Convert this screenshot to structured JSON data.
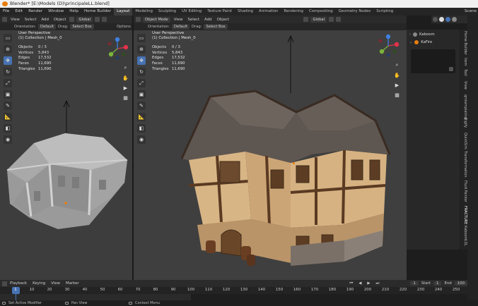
{
  "titlebar": {
    "title": "Blender* [E:\\Models (D)\\principaleLL.blend]"
  },
  "menu": {
    "items": [
      "File",
      "Edit",
      "Render",
      "Window",
      "Help",
      "Home Builder"
    ],
    "workspaces": [
      "Layout",
      "Modeling",
      "Sculpting",
      "UV Editing",
      "Texture Paint",
      "Shading",
      "Animation",
      "Rendering",
      "Compositing",
      "Geometry Nodes",
      "Scripting"
    ],
    "active_workspace": "Layout",
    "right": "Scene"
  },
  "vp_left": {
    "header": {
      "view": "View",
      "select": "Select",
      "add": "Add",
      "object": "Object",
      "transform": "Global",
      "mode": "Object Mode"
    },
    "sub": {
      "orientation_label": "Orientation:",
      "orientation": "Default",
      "drag_label": "Drag:",
      "drag": "Select Box",
      "options": "Options"
    },
    "overlay": {
      "line1": "User Perspective",
      "line2": "(1) Collection | Mesh_0"
    },
    "stats": [
      [
        "Objects",
        "0 / 3"
      ],
      [
        "Vertices",
        "5,843"
      ],
      [
        "Edges",
        "17,532"
      ],
      [
        "Faces",
        "11,690"
      ],
      [
        "Triangles",
        "11,690"
      ]
    ]
  },
  "vp_right": {
    "header": {
      "mode": "Object Mode",
      "view": "View",
      "select": "Select",
      "add": "Add",
      "object": "Object",
      "transform": "Global"
    },
    "sub": {
      "orientation_label": "Orientation:",
      "orientation": "Default",
      "drag_label": "Drag:",
      "drag": "Select Box",
      "options": "Options"
    },
    "overlay": {
      "line1": "User Perspective",
      "line2": "(1) Collection | Mesh_0"
    },
    "stats": [
      [
        "Objects",
        "0 / 3"
      ],
      [
        "Vertices",
        "5,843"
      ],
      [
        "Edges",
        "17,532"
      ],
      [
        "Faces",
        "11,690"
      ],
      [
        "Triangles",
        "11,690"
      ]
    ]
  },
  "outliner": {
    "items": [
      "Kaboom",
      "KaFire"
    ]
  },
  "sidebar_tabs": [
    "Home Builder",
    "Item",
    "Tool",
    "View",
    "qmtemplating",
    "Rigify",
    "QuickSim",
    "Transformation",
    "Fluid Painter",
    "FRACTURE",
    "Kaboom",
    "LSL",
    "Procedural Cit"
  ],
  "timeline": {
    "menus": [
      "Playback",
      "Keying",
      "View",
      "Marker"
    ],
    "current_frame": "1",
    "start_label": "Start",
    "start": "1",
    "end_label": "End",
    "end": "100",
    "ticks": [
      "1",
      "10",
      "20",
      "30",
      "40",
      "50",
      "60",
      "70",
      "80",
      "90",
      "100",
      "110",
      "120",
      "130",
      "140",
      "150",
      "160",
      "170",
      "180",
      "190",
      "200",
      "210",
      "220",
      "230",
      "240",
      "250"
    ]
  },
  "status": {
    "left": "Set Active Modifier",
    "mid": "Pan View",
    "right": "Context Menu"
  },
  "colors": {
    "accent": "#4772b3",
    "playhead": "#4772b3",
    "x_axis": "#e3324a",
    "y_axis": "#7bb33b",
    "z_axis": "#3f7fe0",
    "logo": "#e87d0d"
  }
}
